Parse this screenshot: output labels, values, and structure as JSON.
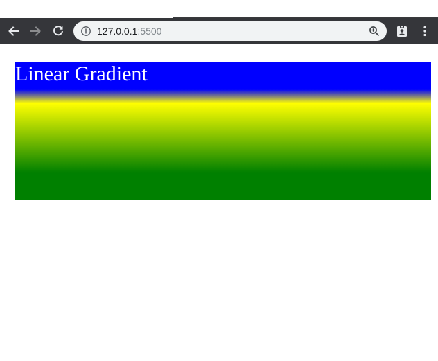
{
  "browser": {
    "address": {
      "host": "127.0.0.1",
      "port": ":5500"
    },
    "icons": {
      "back": "back-arrow-icon",
      "forward": "forward-arrow-icon",
      "reload": "reload-icon",
      "info": "info-icon",
      "zoom": "zoom-icon",
      "profile": "profile-icon",
      "menu": "kebab-menu-icon"
    }
  },
  "page": {
    "heading": "Linear Gradient",
    "gradient_colors": [
      "#0000ff",
      "#ffff00",
      "#008000"
    ],
    "heading_color": "#ffffff"
  }
}
